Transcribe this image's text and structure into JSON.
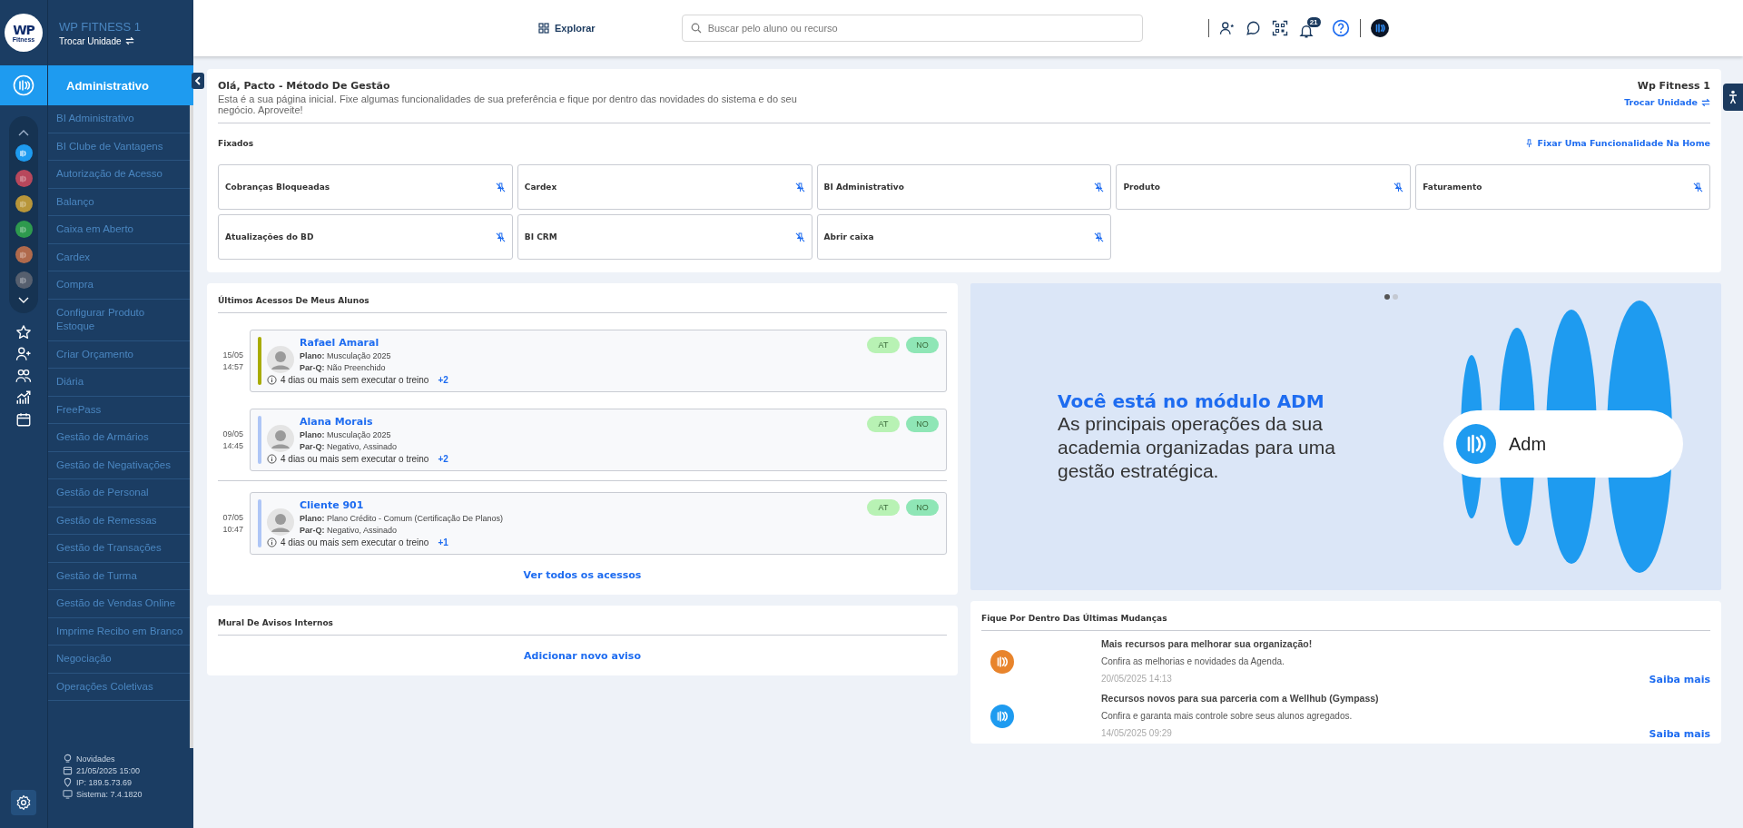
{
  "brand": {
    "logo_text": "WP",
    "logo_sub": "Fitness",
    "unit": "WP FITNESS 1",
    "switch_label": "Trocar Unidade"
  },
  "module_title": "Administrativo",
  "modules": [
    {
      "color": "#1e9bf0",
      "selected": true
    },
    {
      "color": "#b8485c",
      "selected": false
    },
    {
      "color": "#b8963a",
      "selected": false
    },
    {
      "color": "#2e9a4e",
      "selected": false
    },
    {
      "color": "#b06a4c",
      "selected": false
    },
    {
      "color": "#565f6e",
      "selected": false
    }
  ],
  "menu": [
    "BI Administrativo",
    "BI Clube de Vantagens",
    "Autorização de Acesso",
    "Balanço",
    "Caixa em Aberto",
    "Cardex",
    "Compra",
    "Configurar Produto Estoque",
    "Criar Orçamento",
    "Diária",
    "FreePass",
    "Gestão de Armários",
    "Gestão de Negativações",
    "Gestão de Personal",
    "Gestão de Remessas",
    "Gestão de Transações",
    "Gestão de Turma",
    "Gestão de Vendas Online",
    "Imprime Recibo em Branco",
    "Negociação",
    "Operações Coletivas"
  ],
  "sidebar_footer": {
    "news": "Novidades",
    "datetime": "21/05/2025 15:00",
    "ip": "IP: 189.5.73.69",
    "system": "Sistema: 7.4.1820"
  },
  "topbar": {
    "explore": "Explorar",
    "search_placeholder": "Buscar pelo aluno ou recurso",
    "notifications": "21"
  },
  "greeting": {
    "title": "Olá, Pacto - Método De Gestão",
    "text": "Esta é a sua página inicial. Fixe algumas funcionalidades de sua preferência e fique por dentro das novidades do sistema e do seu negócio. Aproveite!",
    "unit": "Wp Fitness 1",
    "switch_label": "Trocar Unidade"
  },
  "pinned": {
    "title": "Fixados",
    "action": "Fixar Uma Funcionalidade Na Home",
    "items": [
      "Cobranças Bloqueadas",
      "Cardex",
      "BI Administrativo",
      "Produto",
      "Faturamento",
      "Atualizações do BD",
      "BI CRM",
      "Abrir caixa"
    ]
  },
  "accesses": {
    "title": "Últimos Acessos De Meus Alunos",
    "link": "Ver todos os acessos",
    "items": [
      {
        "date": "15/05",
        "time": "14:57",
        "color": "#a8ab00",
        "name": "Rafael Amaral",
        "plan": "**Plano:** Musculação 2025",
        "parq": "**Par-Q:** Não Preenchido",
        "alert": "4 dias ou mais sem executar o treino",
        "more": "+2",
        "tags": [
          "AT",
          "NO"
        ],
        "separated": false
      },
      {
        "date": "09/05",
        "time": "14:45",
        "color": "#aec6f6",
        "name": "Alana Morais",
        "plan": "**Plano:** Musculação 2025",
        "parq": "**Par-Q:** Negativo, Assinado",
        "alert": "4 dias ou mais sem executar o treino",
        "more": "+2",
        "tags": [
          "AT",
          "NO"
        ],
        "separated": false
      },
      {
        "date": "07/05",
        "time": "10:47",
        "color": "#aec6f6",
        "name": "Cliente 901",
        "plan": "**Plano:** Plano Crédito - Comum (Certificação De Planos)",
        "parq": "**Par-Q:** Negativo, Assinado",
        "alert": "4 dias ou mais sem executar o treino",
        "more": "+1",
        "tags": [
          "AT",
          "NO"
        ],
        "separated": true
      }
    ]
  },
  "wall": {
    "title": "Mural De Avisos Internos",
    "action": "Adicionar novo aviso"
  },
  "banner": {
    "headline": "Você está no módulo ADM",
    "text": "As principais operações da sua academia organizadas para uma gestão estratégica.",
    "pill": "Adm",
    "dots": [
      {
        "selected": true
      },
      {
        "selected": false
      }
    ]
  },
  "news": {
    "title": "Fique Por Dentro Das Últimas Mudanças",
    "items": [
      {
        "color": "#e8842c",
        "title": "Mais recursos para melhorar sua organização!",
        "text": "Confira as melhorias e novidades da Agenda.",
        "date": "20/05/2025 14:13",
        "link": "Saiba mais"
      },
      {
        "color": "#1e9bf0",
        "title": "Recursos novos para sua parceria com a Wellhub (Gympass)",
        "text": "Confira e garanta mais controle sobre seus alunos agregados.",
        "date": "14/05/2025 09:29",
        "link": "Saiba mais"
      }
    ]
  }
}
